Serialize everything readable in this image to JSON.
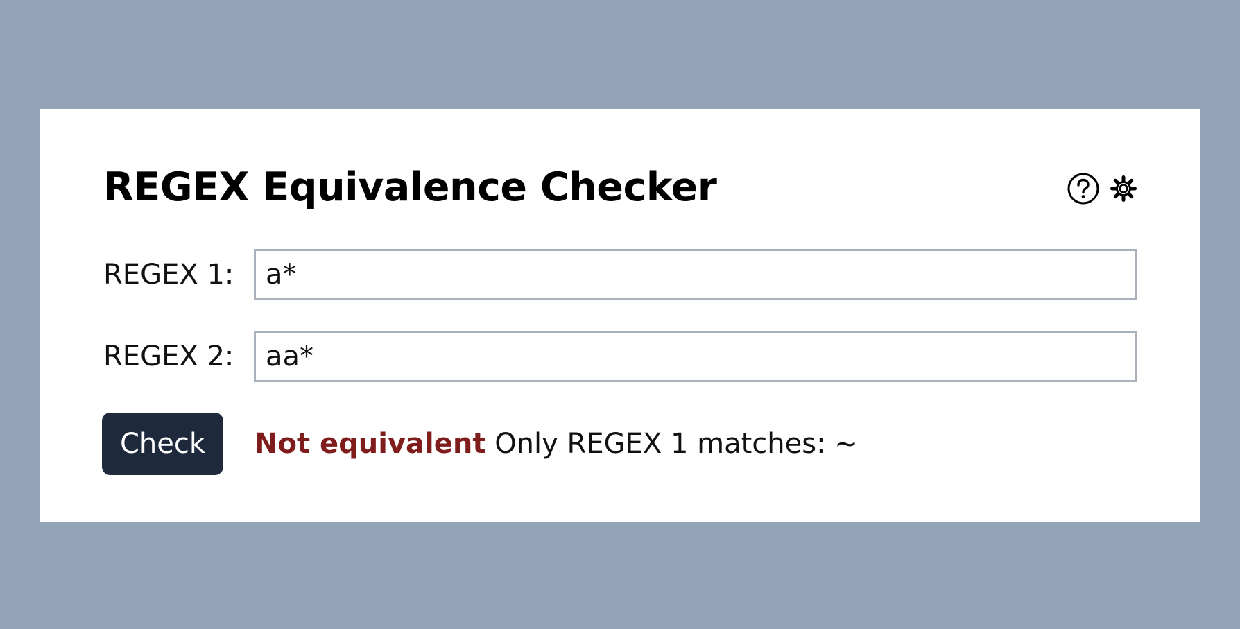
{
  "app": {
    "title": "REGEX Equivalence Checker"
  },
  "header": {
    "help_icon": "question-circle-icon",
    "settings_icon": "gear-icon"
  },
  "form": {
    "regex1": {
      "label": "REGEX 1:",
      "value": "a*"
    },
    "regex2": {
      "label": "REGEX 2:",
      "value": "aa*"
    },
    "check_label": "Check"
  },
  "result": {
    "status": "Not equivalent",
    "message": "Only REGEX 1 matches: ~"
  },
  "colors": {
    "background": "#94a3b8",
    "card": "#ffffff",
    "button": "#1e293b",
    "status_negative": "#7f1d1d",
    "input_border": "#a9b1bd"
  }
}
